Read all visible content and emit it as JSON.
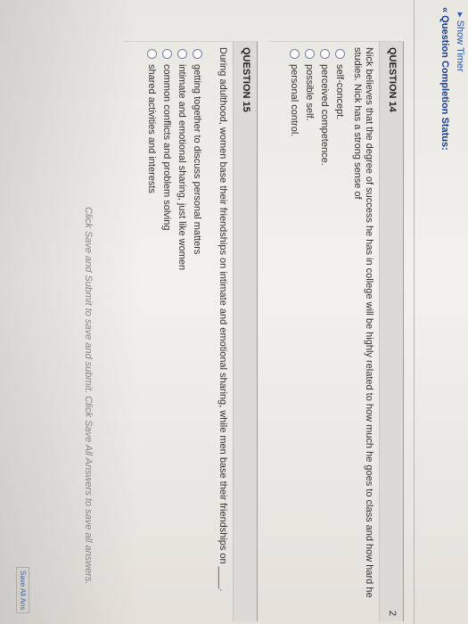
{
  "toolbar": {
    "show_timer": "▸ Show Timer",
    "completion_status": "« Question Completion Status:"
  },
  "questions": [
    {
      "title": "QUESTION 14",
      "points": "2",
      "text": "Nick believes that the degree of success he has in college will be highly related to how much he goes to class and how hard he studies. Nick has a strong sense of",
      "options": [
        "self-concept.",
        "perceived competence.",
        "possible self.",
        "personal control."
      ]
    },
    {
      "title": "QUESTION 15",
      "points": "",
      "text": "During adulthood, women base their friendships on intimate and emotional sharing, while men base their friendships on ____.",
      "options": [
        "getting together to discuss personal matters",
        "intimate and emotional sharing, just like women",
        "common conflicts and problem solving",
        "shared activities and interests"
      ]
    }
  ],
  "footer": {
    "instructions": "Click Save and Submit to save and submit. Click Save All Answers to save all answers.",
    "save_all_label": "Save All Ans"
  }
}
